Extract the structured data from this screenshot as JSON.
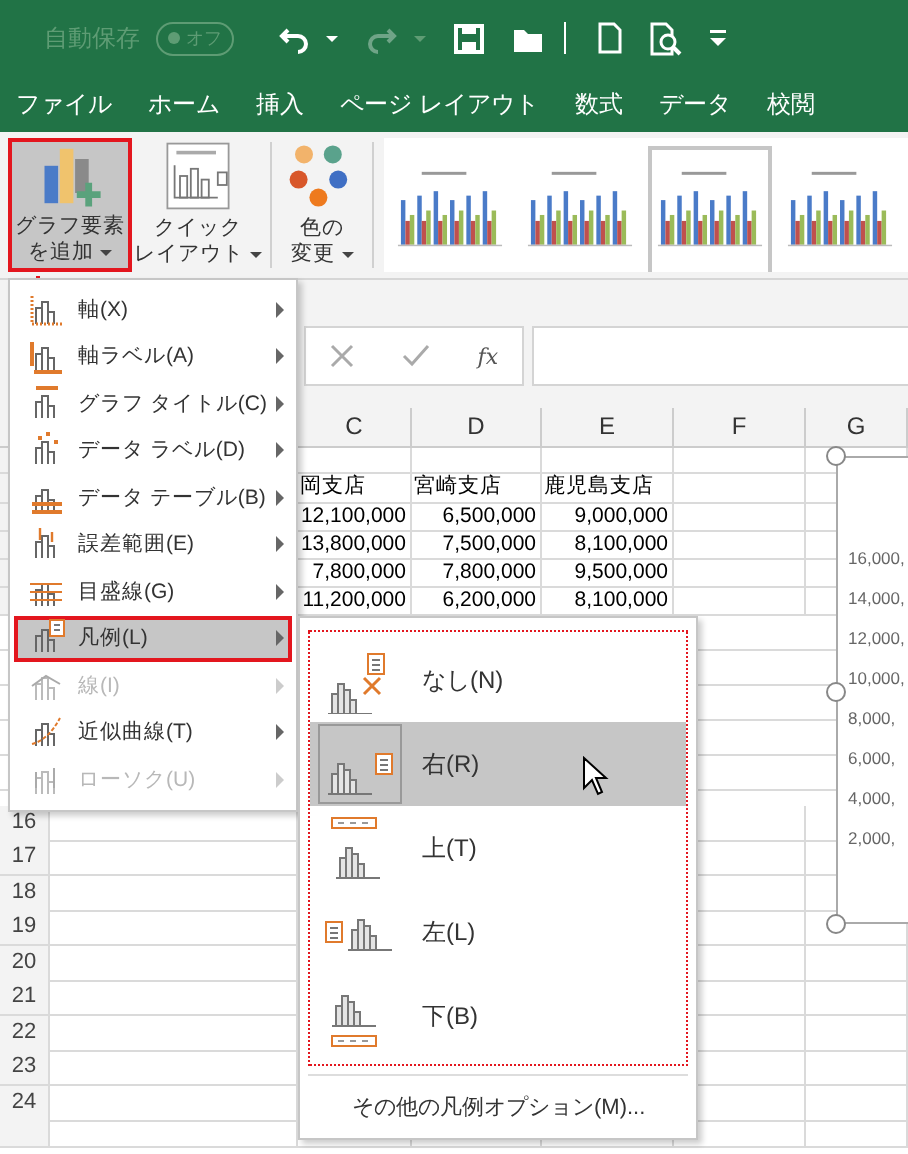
{
  "title_bar": {
    "autosave_label": "自動保存",
    "autosave_toggle": {
      "label": "オフ",
      "on": false
    },
    "redo_disabled": true
  },
  "ribbon_tabs": [
    {
      "label": "ファイル"
    },
    {
      "label": "ホーム"
    },
    {
      "label": "挿入"
    },
    {
      "label": "ページ レイアウト"
    },
    {
      "label": "数式"
    },
    {
      "label": "データ"
    },
    {
      "label": "校閲"
    }
  ],
  "ribbon": {
    "buttons": [
      {
        "kind": "add_element",
        "lines": [
          "グラフ要素",
          "を追加"
        ],
        "pressed": true
      },
      {
        "kind": "quick_layout",
        "lines": [
          "クイック",
          "レイアウト"
        ],
        "pressed": false
      },
      {
        "kind": "colors",
        "lines": [
          "色の",
          "変更"
        ],
        "pressed": false
      }
    ],
    "chart_styles": [
      {
        "selected": false
      },
      {
        "selected": false
      },
      {
        "selected": true
      },
      {
        "selected": false
      }
    ]
  },
  "formula_bar": {
    "function_label": "fx"
  },
  "sheet": {
    "columns": [
      "C",
      "D",
      "E",
      "F",
      "G"
    ],
    "data_rows": [
      {
        "cells": [
          "",
          "",
          "",
          ""
        ]
      },
      {
        "cells": [
          "岡支店",
          "宮崎支店",
          "鹿児島支店",
          ""
        ]
      },
      {
        "cells": [
          "12,100,000",
          "6,500,000",
          "9,000,000",
          ""
        ]
      },
      {
        "cells": [
          "13,800,000",
          "7,500,000",
          "8,100,000",
          ""
        ]
      },
      {
        "cells": [
          "7,800,000",
          "7,800,000",
          "9,500,000",
          ""
        ]
      },
      {
        "cells": [
          "11,200,000",
          "6,200,000",
          "8,100,000",
          ""
        ]
      }
    ],
    "numbered_rows": [
      "16",
      "17",
      "18",
      "19",
      "20",
      "21",
      "22",
      "23",
      "24"
    ]
  },
  "chart": {
    "axis_labels": [
      "16,000,",
      "14,000,",
      "12,000,",
      "10,000,",
      "8,000,",
      "6,000,",
      "4,000,",
      "2,000,"
    ]
  },
  "menu": {
    "items": [
      {
        "kind": "axis",
        "label": "軸(X)",
        "selected": false,
        "disabled": false
      },
      {
        "kind": "axis_title",
        "label": "軸ラベル(A)",
        "selected": false,
        "disabled": false
      },
      {
        "kind": "chart_title",
        "label": "グラフ タイトル(C)",
        "selected": false,
        "disabled": false
      },
      {
        "kind": "data_labels",
        "label": "データ ラベル(D)",
        "selected": false,
        "disabled": false
      },
      {
        "kind": "data_table",
        "label": "データ テーブル(B)",
        "selected": false,
        "disabled": false
      },
      {
        "kind": "error_bars",
        "label": "誤差範囲(E)",
        "selected": false,
        "disabled": false
      },
      {
        "kind": "gridlines",
        "label": "目盛線(G)",
        "selected": false,
        "disabled": false
      },
      {
        "kind": "legend",
        "label": "凡例(L)",
        "selected": true,
        "disabled": false
      },
      {
        "kind": "lines",
        "label": "線(I)",
        "selected": false,
        "disabled": true
      },
      {
        "kind": "trendline",
        "label": "近似曲線(T)",
        "selected": false,
        "disabled": false
      },
      {
        "kind": "updown",
        "label": "ローソク(U)",
        "selected": false,
        "disabled": true
      }
    ]
  },
  "submenu": {
    "items": [
      {
        "kind": "none",
        "label": "なし(N)",
        "selected": false
      },
      {
        "kind": "right",
        "label": "右(R)",
        "selected": true
      },
      {
        "kind": "top",
        "label": "上(T)",
        "selected": false
      },
      {
        "kind": "left",
        "label": "左(L)",
        "selected": false
      },
      {
        "kind": "bottom",
        "label": "下(B)",
        "selected": false
      }
    ],
    "footer": "その他の凡例オプション(M)..."
  }
}
